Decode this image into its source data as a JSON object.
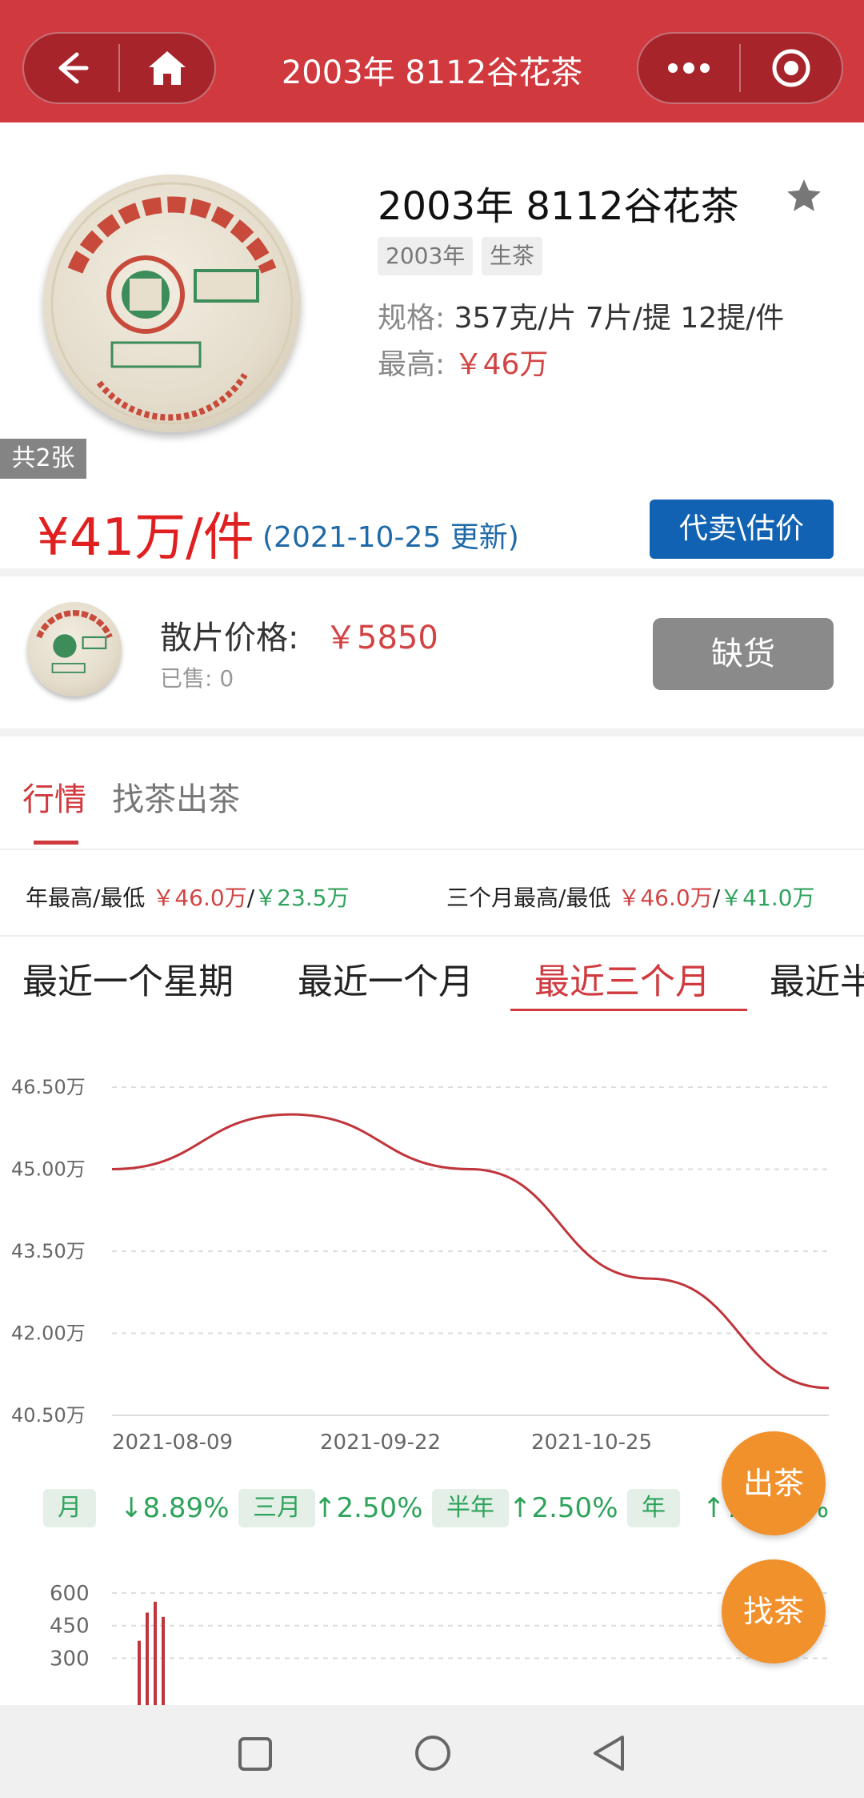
{
  "header": {
    "title": "2003年 8112谷花茶"
  },
  "product": {
    "image_count": "共2张",
    "title": "2003年 8112谷花茶",
    "tags": [
      "2003年",
      "生茶"
    ],
    "spec_label": "规格:",
    "spec_value": "357克/片 7片/提 12提/件",
    "max_label": "最高:",
    "max_value": "￥46万",
    "price": "¥41万/件",
    "price_date": "(2021-10-25 更新)",
    "sell_button": "代卖\\估价"
  },
  "loose": {
    "label": "散片价格:",
    "price": "￥5850",
    "sold": "已售: 0",
    "button": "缺货"
  },
  "tabs": [
    "行情",
    "找茶出茶"
  ],
  "stats": {
    "year_label": "年最高/最低",
    "year_high": "￥46.0万",
    "sep": "/",
    "year_low": "￥23.5万",
    "three_label": "三个月最高/最低",
    "three_high": "￥46.0万",
    "three_low": "￥41.0万"
  },
  "ranges": [
    "最近一个星期",
    "最近一个月",
    "最近三个月",
    "最近半"
  ],
  "chart_data": [
    {
      "type": "line",
      "x": [
        "2021-08-09",
        "2021-08-30",
        "2021-09-22",
        "2021-10-10",
        "2021-10-25"
      ],
      "y_ticks": [
        "46.50万",
        "45.00万",
        "43.50万",
        "42.00万",
        "40.50万"
      ],
      "x_ticks": [
        "2021-08-09",
        "2021-09-22",
        "2021-10-25"
      ],
      "ylim": [
        40.5,
        46.5
      ],
      "series": [
        {
          "values": [
            45.0,
            46.0,
            45.0,
            43.0,
            41.0
          ]
        }
      ],
      "color": "#c0353c",
      "grid": true
    },
    {
      "type": "bar",
      "y_ticks": [
        "600",
        "450",
        "300"
      ],
      "ylim": [
        150,
        600
      ],
      "values": [
        380,
        510,
        560,
        490
      ],
      "color": "#c0353c",
      "grid": true
    }
  ],
  "changes": [
    {
      "label": "月",
      "value": "↓8.89%"
    },
    {
      "label": "三月",
      "value": "↑2.50%"
    },
    {
      "label": "半年",
      "value": "↑2.50%"
    },
    {
      "label": "年",
      "value": "↑78.26%"
    }
  ],
  "fabs": {
    "sell": "出茶",
    "find": "找茶"
  },
  "icons": {
    "back": "back-arrow-icon",
    "home": "home-icon",
    "more": "more-dots-icon",
    "target": "target-icon",
    "star": "star-icon",
    "nav_square": "square-icon",
    "nav_circle": "circle-icon",
    "nav_back": "triangle-back-icon"
  }
}
